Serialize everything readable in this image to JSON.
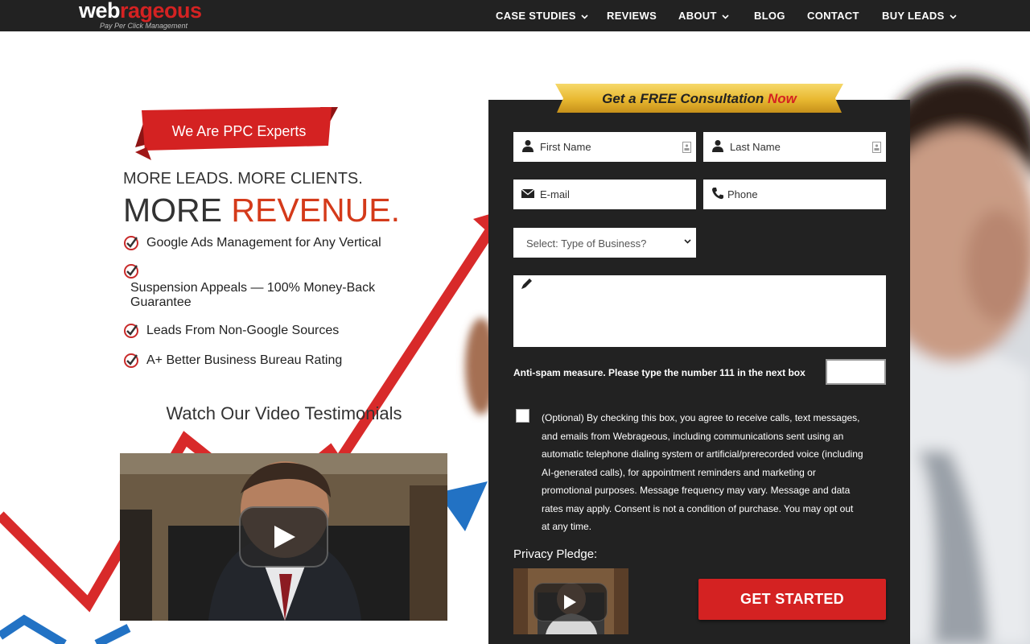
{
  "brand": {
    "logo_part1": "web",
    "logo_part2": "rageous",
    "tagline": "Pay Per Click Management"
  },
  "nav": {
    "items": [
      {
        "label": "CASE STUDIES",
        "has_dropdown": true
      },
      {
        "label": "REVIEWS",
        "has_dropdown": false
      },
      {
        "label": "ABOUT",
        "has_dropdown": true
      },
      {
        "label": "BLOG",
        "has_dropdown": false
      },
      {
        "label": "CONTACT",
        "has_dropdown": false
      },
      {
        "label": "BUY LEADS",
        "has_dropdown": true
      }
    ]
  },
  "hero": {
    "ribbon_text": "We Are PPC Experts",
    "headline_line1": "MORE LEADS. MORE CLIENTS.",
    "headline_line2_prefix": "MORE ",
    "headline_line2_accent": "REVENUE.",
    "benefits": [
      "Google Ads Management for Any Vertical",
      "Suspension Appeals — 100% Money-Back Guarantee",
      "Leads From Non-Google Sources",
      "A+ Better Business Bureau Rating"
    ],
    "video_heading": "Watch Our Video Testimonials"
  },
  "form": {
    "cta_prefix": "Get a FREE Consultation ",
    "cta_accent": "Now",
    "first_name_placeholder": "First Name",
    "last_name_placeholder": "Last Name",
    "email_placeholder": "E-mail",
    "phone_placeholder": "Phone",
    "business_type_selected": "Select: Type of Business?",
    "antispam_label": "Anti-spam measure. Please type the number 111 in the next box",
    "antispam_value": "",
    "consent_text": "(Optional) By checking this box, you agree to receive calls, text messages, and emails from Webrageous, including communications sent using an automatic telephone dialing system or artificial/prerecorded voice (including AI-generated calls), for appointment reminders and marketing or promotional purposes. Message frequency may vary. Message and data rates may apply. Consent is not a condition of purchase. You may opt out at any time.",
    "privacy_pledge_label": "Privacy Pledge:",
    "submit_label": "GET STARTED"
  },
  "colors": {
    "nav_bg": "#222222",
    "accent_red": "#d42222",
    "headline_red": "#d43a1a",
    "form_bg": "#222222",
    "cta_gold": "#e8b830",
    "arrow_blue": "#2272c4"
  },
  "icons": {
    "name_field": "person-icon",
    "email_field": "envelope-icon",
    "phone_field": "phone-icon",
    "message_field": "pencil-icon",
    "benefit_bullet": "check-badge-icon",
    "video": "play-icon"
  }
}
